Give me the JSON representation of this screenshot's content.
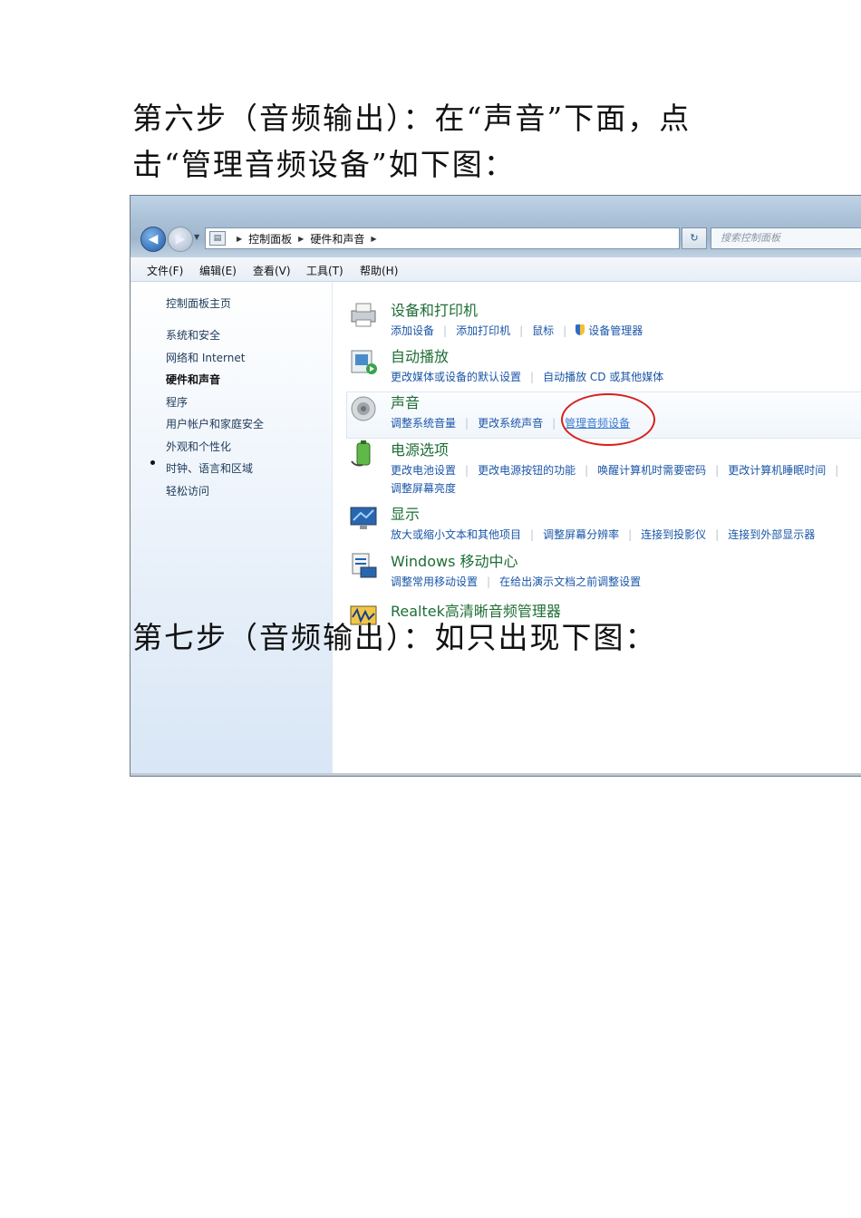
{
  "document": {
    "step6_line1": "第六步（音频输出）：在“声音”下面，点",
    "step6_line2": "击“管理音频设备”如下图：",
    "step7": "第七步（音频输出）：如只出现下图："
  },
  "window": {
    "breadcrumb": [
      "控制面板",
      "硬件和声音"
    ],
    "search_placeholder": "搜索控制面板",
    "menu": [
      "文件(F)",
      "编辑(E)",
      "查看(V)",
      "工具(T)",
      "帮助(H)"
    ]
  },
  "sidebar": {
    "home": "控制面板主页",
    "items": [
      "系统和安全",
      "网络和 Internet",
      "硬件和声音",
      "程序",
      "用户帐户和家庭安全",
      "外观和个性化",
      "时钟、语言和区域",
      "轻松访问"
    ],
    "active_index": 2
  },
  "categories": [
    {
      "title": "设备和打印机",
      "links": [
        "添加设备",
        "添加打印机",
        "鼠标",
        "设备管理器"
      ]
    },
    {
      "title": "自动播放",
      "links": [
        "更改媒体或设备的默认设置",
        "自动播放 CD 或其他媒体"
      ]
    },
    {
      "title": "声音",
      "links": [
        "调整系统音量",
        "更改系统声音",
        "管理音频设备"
      ]
    },
    {
      "title": "电源选项",
      "links": [
        "更改电池设置",
        "更改电源按钮的功能",
        "唤醒计算机时需要密码",
        "更改计算机睡眠时间"
      ],
      "links2": [
        "调整屏幕亮度"
      ]
    },
    {
      "title": "显示",
      "links": [
        "放大或缩小文本和其他项目",
        "调整屏幕分辨率",
        "连接到投影仪",
        "连接到外部显示器"
      ]
    },
    {
      "title": "Windows 移动中心",
      "links": [
        "调整常用移动设置",
        "在给出演示文档之前调整设置"
      ]
    },
    {
      "title": "Realtek高清晰音频管理器",
      "links": []
    }
  ],
  "annotation_color": "#d8201c"
}
